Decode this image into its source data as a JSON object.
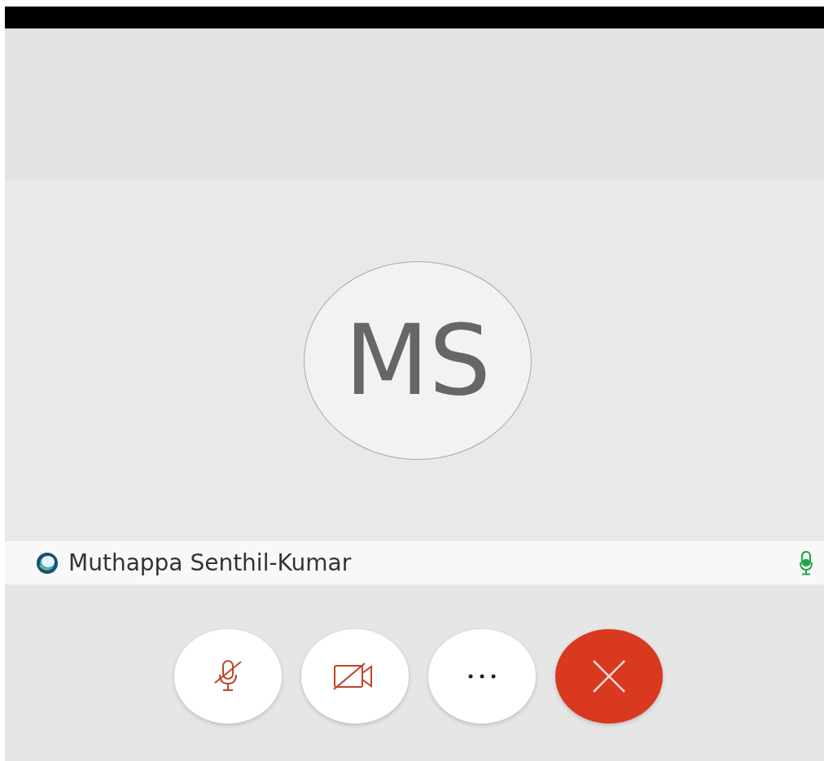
{
  "participant": {
    "initials": "MS",
    "name": "Muthappa Senthil-Kumar",
    "mic_on": true
  },
  "controls": [
    {
      "kind": "mic",
      "off": true
    },
    {
      "kind": "camera",
      "off": true
    },
    {
      "kind": "more"
    },
    {
      "kind": "end"
    }
  ]
}
